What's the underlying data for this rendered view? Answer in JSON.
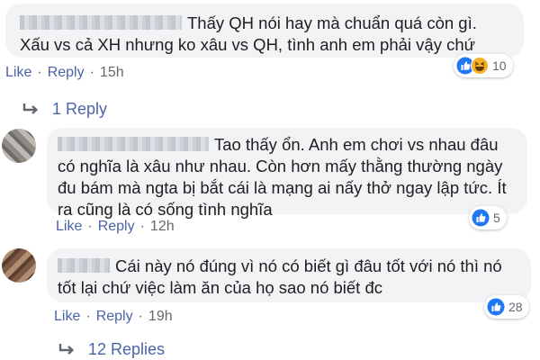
{
  "comments": [
    {
      "text": "Thấy QH nói hay mà chuẩn quá còn gì. Xấu vs cả XH nhưng ko xâu vs QH, tình anh em phải vậy chứ",
      "actions": {
        "like": "Like",
        "reply": "Reply",
        "time": "15h"
      },
      "reaction_count": "10",
      "reaction_icons": [
        "like-icon",
        "haha-icon"
      ]
    },
    {
      "text": "Tao thấy ổn. Anh em chơi vs nhau đâu có nghĩa là xâu như nhau. Còn hơn mấy thằng thường ngày đu bám mà ngta bị bắt cái là mạng ai nấy thở ngay lập tức. Ít ra cũng là có sống tình nghĩa",
      "actions": {
        "like": "Like",
        "reply": "Reply",
        "time": "12h"
      },
      "reaction_count": "5",
      "reaction_icons": [
        "like-icon"
      ]
    },
    {
      "text": "Cái này nó đúng vì nó có biết gì đâu tốt với nó thì nó tốt lại chứ việc làm ăn của họ sao nó biết đc",
      "actions": {
        "like": "Like",
        "reply": "Reply",
        "time": "19h"
      },
      "reaction_count": "28",
      "reaction_icons": [
        "like-icon"
      ]
    }
  ],
  "reply_links": [
    {
      "label": "1 Reply"
    },
    {
      "label": "12 Replies"
    }
  ],
  "colors": {
    "like_blue": "#2078f4",
    "haha_yellow": "#f7b125",
    "link_blue": "#4b64a6",
    "bubble_gray": "#f2f3f5"
  }
}
